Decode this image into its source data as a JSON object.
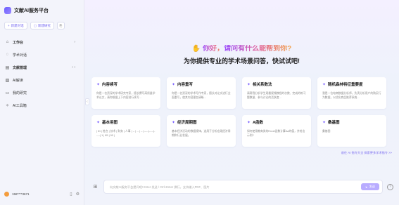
{
  "app": {
    "title": "文献AI服务平台"
  },
  "sidebar": {
    "buttons": {
      "new_chat": "新建对话",
      "new_research": "新建研究"
    },
    "items": [
      {
        "label": "工作台",
        "icon": "home-icon",
        "has_chevron": true
      },
      {
        "label": "学术对话",
        "icon": "chat-icon",
        "has_chevron": false
      },
      {
        "label": "文献管理",
        "icon": "library-icon",
        "has_chevron": true
      },
      {
        "label": "AI解读",
        "icon": "document-icon",
        "has_chevron": false
      },
      {
        "label": "我的研究",
        "icon": "research-icon",
        "has_chevron": false
      },
      {
        "label": "AI工具箱",
        "icon": "toolbox-icon",
        "has_chevron": false
      }
    ],
    "user": {
      "name": "158****3671"
    }
  },
  "hero": {
    "greeting_plain": "你好，",
    "greeting_highlight": "请问有什么能帮到你?",
    "subtitle": "为你提供专业的学术场景问答，快试试吧!"
  },
  "cards": [
    {
      "title": "内容续写",
      "desc": "你是一名资深的学术研究专家，擅长撰写高质量学术论文，请你根据上下内容进行续写..."
    },
    {
      "title": "内容重写",
      "desc": "你是一名资深的学术写作专家，擅长对论文进行全面重写，使其内容更加清晰..."
    },
    {
      "title": "相关系数法",
      "desc": "请帮我分析学生观看视频教程的次数、完成的练习题数量、参与讨论的活跃度..."
    },
    {
      "title": "随机森林特征重要度",
      "desc": "我是一位电商数据分析师，负责分析用户的购买行为数据，以优化商品推荐系统..."
    },
    {
      "title": "基本用图",
      "desc": "| ID | 姓名 | 技术 | 财务 | 人事 | -- | -- | -- |-----|-----|-----| 1 | 85 | 90 |"
    },
    {
      "title": "经济周期图",
      "desc": "基本经济活动的数据规律，选用于分析宏观经济周期和行业发展。"
    },
    {
      "title": "A函数",
      "desc": "如何使用教育类的Excel函数计算Aa的值，并给出示例?"
    },
    {
      "title": "桑基图",
      "desc": "桑基图"
    }
  ],
  "more_link": "前往 AI 指令大全 探索更多学术指令 >>",
  "input": {
    "placeholder": "向文献AI服务平台提问吧! Enter 发送 / Ctrl+Enter 换行，支持输入PDF、图片",
    "send_label": "发送"
  },
  "colors": {
    "accent": "#7b61ff",
    "send_button": "#b9acff",
    "sidebar_bg": "#f3f4fb"
  }
}
